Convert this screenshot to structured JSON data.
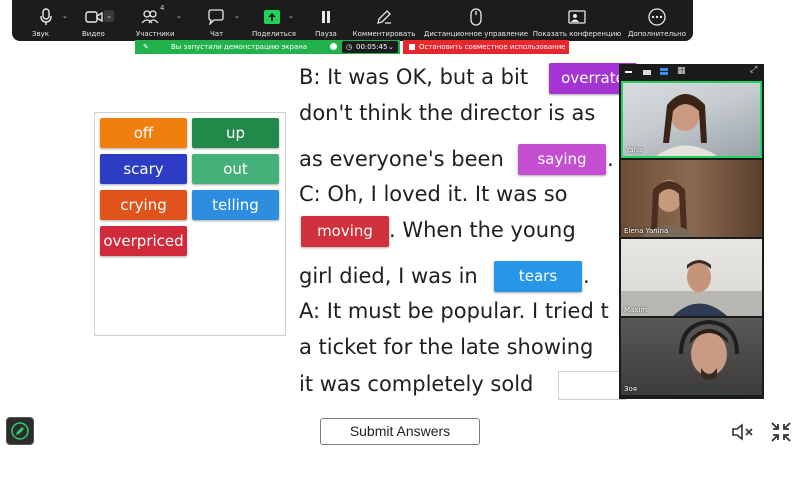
{
  "toolbar": {
    "items": [
      {
        "label": "Звук",
        "icon": "microphone-icon"
      },
      {
        "label": "Видео",
        "icon": "video-camera-icon"
      },
      {
        "label": "Участники",
        "icon": "participants-icon",
        "count": "4"
      },
      {
        "label": "Чат",
        "icon": "chat-icon"
      },
      {
        "label": "Поделиться",
        "icon": "share-screen-icon"
      },
      {
        "label": "Пауза",
        "icon": "pause-icon"
      },
      {
        "label": "Комментировать",
        "icon": "annotate-pen-icon"
      },
      {
        "label": "Дистанционное управление",
        "icon": "remote-control-icon"
      },
      {
        "label": "Показать конференцию",
        "icon": "show-meeting-icon"
      },
      {
        "label": "Дополнительно",
        "icon": "more-icon"
      }
    ],
    "share_accent": "#22b24c"
  },
  "share_status": {
    "text": "Вы запустили демонстрацию экрана",
    "timer": "00:05:45",
    "stop_label": "Остановить совместное использование"
  },
  "word_bank": [
    {
      "label": "off",
      "color": "#f07f10"
    },
    {
      "label": "up",
      "color": "#21894a"
    },
    {
      "label": "scary",
      "color": "#2c3cc4"
    },
    {
      "label": "out",
      "color": "#45b07a"
    },
    {
      "label": "crying",
      "color": "#e0541c"
    },
    {
      "label": "telling",
      "color": "#2d8ee0"
    },
    {
      "label": "overpriced",
      "color": "#d12a3a"
    }
  ],
  "passage": {
    "lines": [
      "B: It was OK, but a bit",
      "don't think the director is as",
      "as everyone's been",
      ".",
      "C: Oh, I loved it. It was so",
      ". When the young",
      "girl died, I was in",
      ".",
      "A: It must be popular. I tried t",
      "a ticket for the late showing",
      "it was completely sold"
    ],
    "filled": [
      {
        "label": "overrate",
        "color": "#a534d4"
      },
      {
        "label": "saying",
        "color": "#c44fd0"
      },
      {
        "label": "moving",
        "color": "#d1303d"
      },
      {
        "label": "tears",
        "color": "#2896e6"
      }
    ]
  },
  "video_panel": {
    "participants": [
      {
        "name": "Yana",
        "active": true
      },
      {
        "name": "Elena Yanina",
        "active": false
      },
      {
        "name": "Maxim",
        "active": false
      },
      {
        "name": "Зоя",
        "active": false
      }
    ],
    "active_color": "#23d160"
  },
  "submit_label": "Submit Answers"
}
